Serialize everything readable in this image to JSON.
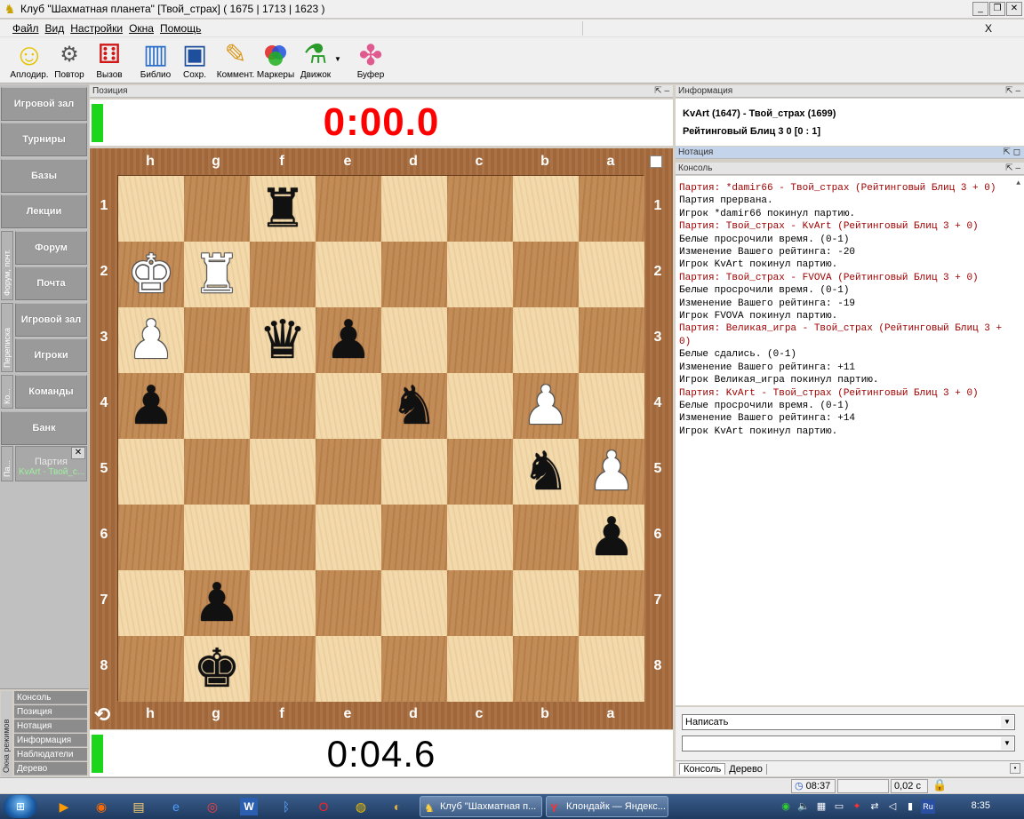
{
  "window": {
    "title": "Клуб \"Шахматная планета\" [Твой_страх]  ( 1675 | 1713 | 1623 )",
    "close_glyph": "✕",
    "max_glyph": "❐",
    "min_glyph": "_"
  },
  "menu": {
    "items": [
      "Файл",
      "Вид",
      "Настройки",
      "Окна",
      "Помощь"
    ],
    "close": "X"
  },
  "toolbar": {
    "tools": [
      {
        "label": "Аплодир.",
        "icon": "smiley-icon",
        "glyph": "☺",
        "color": "#e6c200"
      },
      {
        "label": "Повтор",
        "icon": "replay-icon",
        "glyph": "⚙",
        "color": "#555555"
      },
      {
        "label": "Вызов",
        "icon": "dice-icon",
        "glyph": "⚅",
        "color": "#d01818"
      },
      {
        "label": "Библио",
        "icon": "books-icon",
        "glyph": "▥",
        "color": "#2a6ec8"
      },
      {
        "label": "Сохр.",
        "icon": "floppy-icon",
        "glyph": "▣",
        "color": "#1e4f9c"
      },
      {
        "label": "Коммент.",
        "icon": "pencil-icon",
        "glyph": "✎",
        "color": "#d89a20"
      },
      {
        "label": "Маркеры",
        "icon": "markers-icon",
        "glyph": "●",
        "color": "#c02080"
      },
      {
        "label": "Движок",
        "icon": "flask-icon",
        "glyph": "⚗",
        "color": "#2a9a2a"
      },
      {
        "label": "Буфер",
        "icon": "puzzle-icon",
        "glyph": "✤",
        "color": "#e05a90"
      }
    ],
    "dropdown_glyph": "▼"
  },
  "sidebar": {
    "nav": [
      {
        "label": "Игровой зал",
        "sub": false
      },
      {
        "label": "Турниры",
        "sub": false
      },
      {
        "label": "Базы",
        "sub": false
      },
      {
        "label": "Лекции",
        "sub": false
      },
      {
        "label": "Форум",
        "sub": true
      },
      {
        "label": "Почта",
        "sub": true
      },
      {
        "label": "Игровой зал",
        "sub": true
      },
      {
        "label": "Игроки",
        "sub": true
      },
      {
        "label": "Команды",
        "sub": true
      },
      {
        "label": "Банк",
        "sub": false
      }
    ],
    "vtabs": [
      "Форум, почт.",
      "Переписка",
      "Ко...",
      "Па..."
    ],
    "party": {
      "title": "Партия",
      "players": "KvArt - Твой_с...",
      "close": "✕"
    }
  },
  "modes": {
    "label": "Окна режимов",
    "items": [
      "Консоль",
      "Позиция",
      "Нотация",
      "Информация",
      "Наблюдатели",
      "Дерево"
    ]
  },
  "position_panel": {
    "header": "Позиция",
    "header_buttons": "⇱ ‒",
    "clock_top": "0:00.0",
    "clock_bottom": "0:04.6",
    "clock_top_color": "#ff0000"
  },
  "board": {
    "files": [
      "h",
      "g",
      "f",
      "e",
      "d",
      "c",
      "b",
      "a"
    ],
    "ranks": [
      "1",
      "2",
      "3",
      "4",
      "5",
      "6",
      "7",
      "8"
    ],
    "pieces": {
      "1-2": {
        "glyph": "♜",
        "color": "black"
      },
      "2-0": {
        "glyph": "♚",
        "color": "white"
      },
      "2-1": {
        "glyph": "♜",
        "color": "white"
      },
      "3-0": {
        "glyph": "♟",
        "color": "white"
      },
      "3-2": {
        "glyph": "♛",
        "color": "black"
      },
      "3-3": {
        "glyph": "♟",
        "color": "black"
      },
      "4-0": {
        "glyph": "♟",
        "color": "black"
      },
      "4-4": {
        "glyph": "♞",
        "color": "black"
      },
      "4-6": {
        "glyph": "♟",
        "color": "white"
      },
      "5-6": {
        "glyph": "♞",
        "color": "black"
      },
      "5-7": {
        "glyph": "♟",
        "color": "white"
      },
      "6-7": {
        "glyph": "♟",
        "color": "black"
      },
      "7-1": {
        "glyph": "♟",
        "color": "black"
      },
      "8-1": {
        "glyph": "♚",
        "color": "black"
      }
    },
    "flip_glyph": "⟲"
  },
  "info_panel": {
    "header": "Информация",
    "header_buttons": "⇱ ‒",
    "line1": "KvArt (1647) - Твой_страх (1699)",
    "line2": "Рейтинговый Блиц 3 0 [0 : 1]"
  },
  "notation_panel": {
    "header": "Нотация",
    "header_buttons": "⇱ ◻"
  },
  "console_panel": {
    "header": "Консоль",
    "header_buttons": "⇱ ‒",
    "lines": [
      {
        "text": "Партия: *damir66 - Твой_страх (Рейтинговый Блиц 3 + 0)",
        "red": true
      },
      {
        "text": "Партия прервана.",
        "red": false
      },
      {
        "text": "Игрок *damir66 покинул партию.",
        "red": false
      },
      {
        "text": "Партия: Твой_страх - KvArt (Рейтинговый Блиц 3 + 0)",
        "red": true
      },
      {
        "text": "Белые просрочили время. (0-1)",
        "red": false
      },
      {
        "text": "Изменение Вашего рейтинга: -20",
        "red": false
      },
      {
        "text": "Игрок KvArt покинул партию.",
        "red": false
      },
      {
        "text": "Партия: Твой_страх - FVOVA (Рейтинговый Блиц 3 + 0)",
        "red": true
      },
      {
        "text": "Белые просрочили время. (0-1)",
        "red": false
      },
      {
        "text": "Изменение Вашего рейтинга: -19",
        "red": false
      },
      {
        "text": "Игрок FVOVA покинул партию.",
        "red": false
      },
      {
        "text": "Партия: Великая_игра - Твой_страх (Рейтинговый Блиц 3 + 0)",
        "red": true
      },
      {
        "text": "Белые сдались. (0-1)",
        "red": false
      },
      {
        "text": "Изменение Вашего рейтинга: +11",
        "red": false
      },
      {
        "text": "Игрок Великая_игра покинул партию.",
        "red": false
      },
      {
        "text": "Партия: KvArt - Твой_страх (Рейтинговый Блиц 3 + 0)",
        "red": true
      },
      {
        "text": "Белые просрочили время. (0-1)",
        "red": false
      },
      {
        "text": "Изменение Вашего рейтинга: +14",
        "red": false
      },
      {
        "text": "Игрок KvArt покинул партию.",
        "red": false
      }
    ],
    "scroll_glyph": "▲"
  },
  "input": {
    "mode_value": "Написать",
    "message_value": "",
    "arrow": "▼"
  },
  "bottom_tabs": {
    "tabs": [
      "Консоль",
      "Дерево"
    ],
    "dot": "•"
  },
  "statusbar": {
    "time": "08:37",
    "lag": "0,02 c"
  },
  "taskbar": {
    "start": "⊞",
    "tasks": [
      {
        "label": "Клуб \"Шахматная п...",
        "icon": "♞"
      },
      {
        "label": "Клондайк — Яндекс...",
        "icon": "Y"
      }
    ],
    "tray_lang": "Ru",
    "clock": "8:35"
  }
}
